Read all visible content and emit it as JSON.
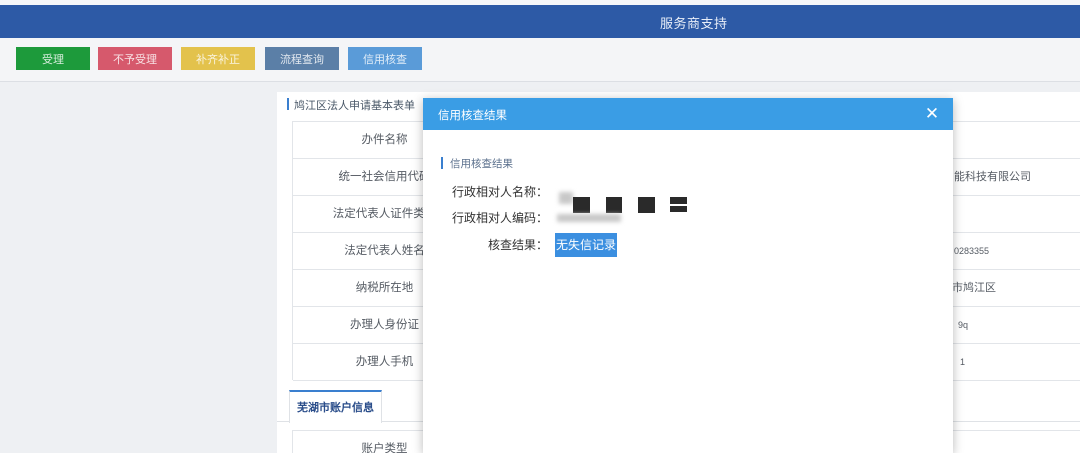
{
  "header": {
    "title": "服务商支持",
    "color": "#2d5aa6"
  },
  "toolbar": {
    "buttons": [
      {
        "label": "受理",
        "color": "#1d9a3b"
      },
      {
        "label": "不予受理",
        "color": "#d6596c"
      },
      {
        "label": "补齐补正",
        "color": "#e3c24c"
      },
      {
        "label": "流程查询",
        "color": "#5b7fa7"
      },
      {
        "label": "信用核查",
        "color": "#5a9bd8"
      }
    ]
  },
  "form": {
    "title": "鸠江区法人申请基本表单",
    "rows": [
      {
        "label": "办件名称"
      },
      {
        "label": "统一社会信用代码",
        "value": "能科技有限公司"
      },
      {
        "label": "法定代表人证件类型"
      },
      {
        "label": "法定代表人姓名",
        "value": "0283355"
      },
      {
        "label": "纳税所在地",
        "value": "市鸠江区"
      },
      {
        "label": "办理人身份证",
        "value": "9q"
      },
      {
        "label": "办理人手机",
        "value": "1"
      }
    ]
  },
  "tabs": [
    {
      "label": "芜湖市账户信息"
    }
  ],
  "account": {
    "label": "账户类型"
  },
  "modal": {
    "title": "信用核查结果",
    "close_icon": "close-icon",
    "header_color": "#3a9de5",
    "section_title": "信用核查结果",
    "fields": [
      {
        "label": "行政相对人名称："
      },
      {
        "label": "行政相对人编码："
      }
    ],
    "result_label": "核查结果：",
    "result_value": "无失信记录",
    "result_color": "#3b8fe0"
  }
}
